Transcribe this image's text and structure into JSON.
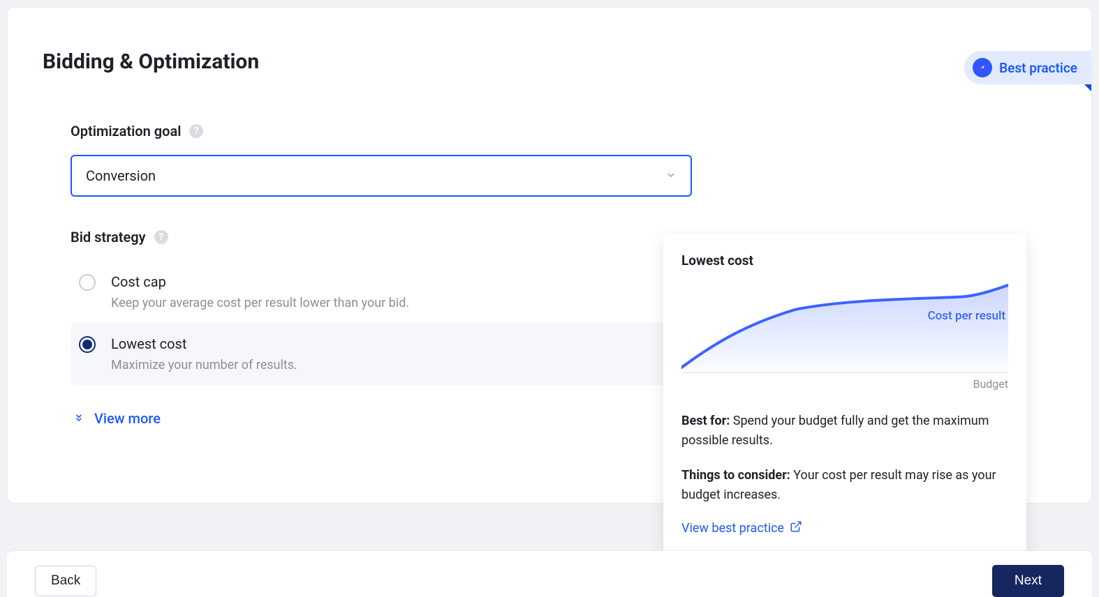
{
  "page": {
    "title": "Bidding & Optimization",
    "best_practice_pill": "Best practice"
  },
  "optimization_goal": {
    "label": "Optimization goal",
    "selected": "Conversion"
  },
  "bid_strategy": {
    "label": "Bid strategy",
    "options": [
      {
        "title": "Cost cap",
        "desc": "Keep your average cost per result lower than your bid.",
        "selected": false
      },
      {
        "title": "Lowest cost",
        "desc": "Maximize your number of results.",
        "selected": true
      }
    ],
    "view_more": "View more"
  },
  "tooltip": {
    "title": "Lowest cost",
    "chart_label": "Cost per result",
    "x_axis": "Budget",
    "best_for_label": "Best for:",
    "best_for_text": " Spend your budget fully and get the maximum possible results.",
    "consider_label": "Things to consider:",
    "consider_text": " Your cost per result may rise as your budget increases.",
    "link": "View best practice"
  },
  "footer": {
    "back": "Back",
    "next": "Next"
  },
  "chart_data": {
    "type": "line",
    "title": "Lowest cost",
    "xlabel": "Budget",
    "ylabel": "Cost per result",
    "x": [
      0,
      0.1,
      0.2,
      0.35,
      0.5,
      0.7,
      0.85,
      1.0
    ],
    "values": [
      0.05,
      0.3,
      0.5,
      0.65,
      0.72,
      0.76,
      0.78,
      0.9
    ]
  }
}
